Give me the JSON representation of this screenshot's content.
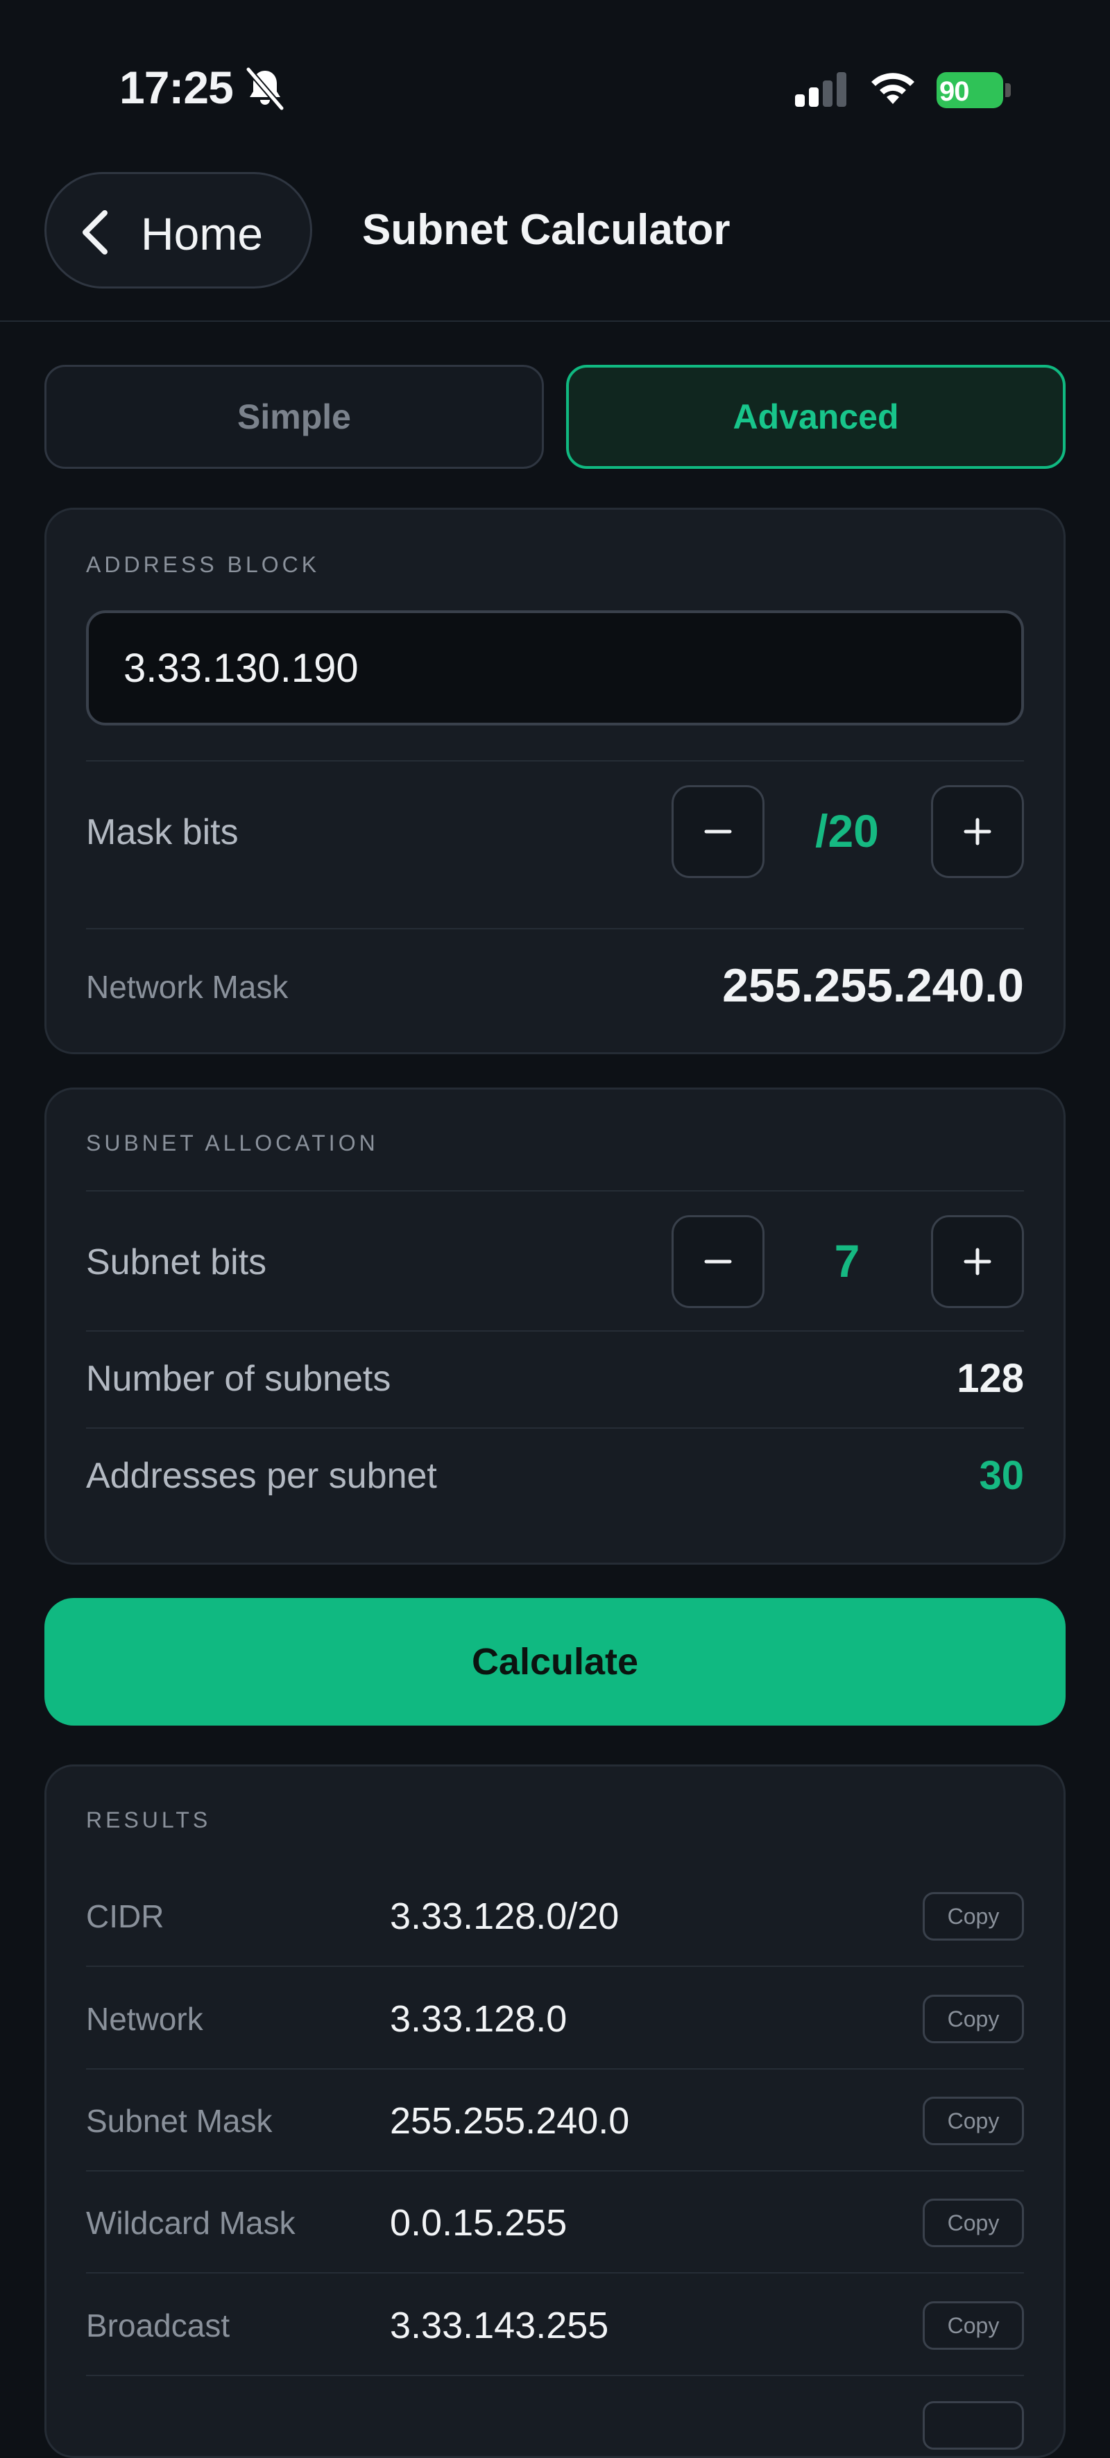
{
  "status_bar": {
    "time": "17:25",
    "battery": "90"
  },
  "header": {
    "back_label": "Home",
    "title": "Subnet Calculator"
  },
  "tabs": [
    {
      "label": "Simple",
      "selected": false
    },
    {
      "label": "Advanced",
      "selected": true
    }
  ],
  "address_block": {
    "section_label": "ADDRESS BLOCK",
    "address_value": "3.33.130.190",
    "mask_bits_label": "Mask bits",
    "mask_bits_value": "/20",
    "network_mask_label": "Network Mask",
    "network_mask_value": "255.255.240.0"
  },
  "subnet_allocation": {
    "section_label": "SUBNET ALLOCATION",
    "subnet_bits_label": "Subnet bits",
    "subnet_bits_value": "7",
    "num_subnets_label": "Number of subnets",
    "num_subnets_value": "128",
    "addresses_label": "Addresses per subnet",
    "addresses_value": "30"
  },
  "calculate_label": "Calculate",
  "results": {
    "section_label": "RESULTS",
    "copy_label": "Copy",
    "rows": [
      {
        "label": "CIDR",
        "value": "3.33.128.0/20"
      },
      {
        "label": "Network",
        "value": "3.33.128.0"
      },
      {
        "label": "Subnet Mask",
        "value": "255.255.240.0"
      },
      {
        "label": "Wildcard Mask",
        "value": "0.0.15.255"
      },
      {
        "label": "Broadcast",
        "value": "3.33.143.255"
      }
    ]
  },
  "colors": {
    "accent": "#10b981",
    "background": "#0d1116",
    "card": "#171c23"
  }
}
